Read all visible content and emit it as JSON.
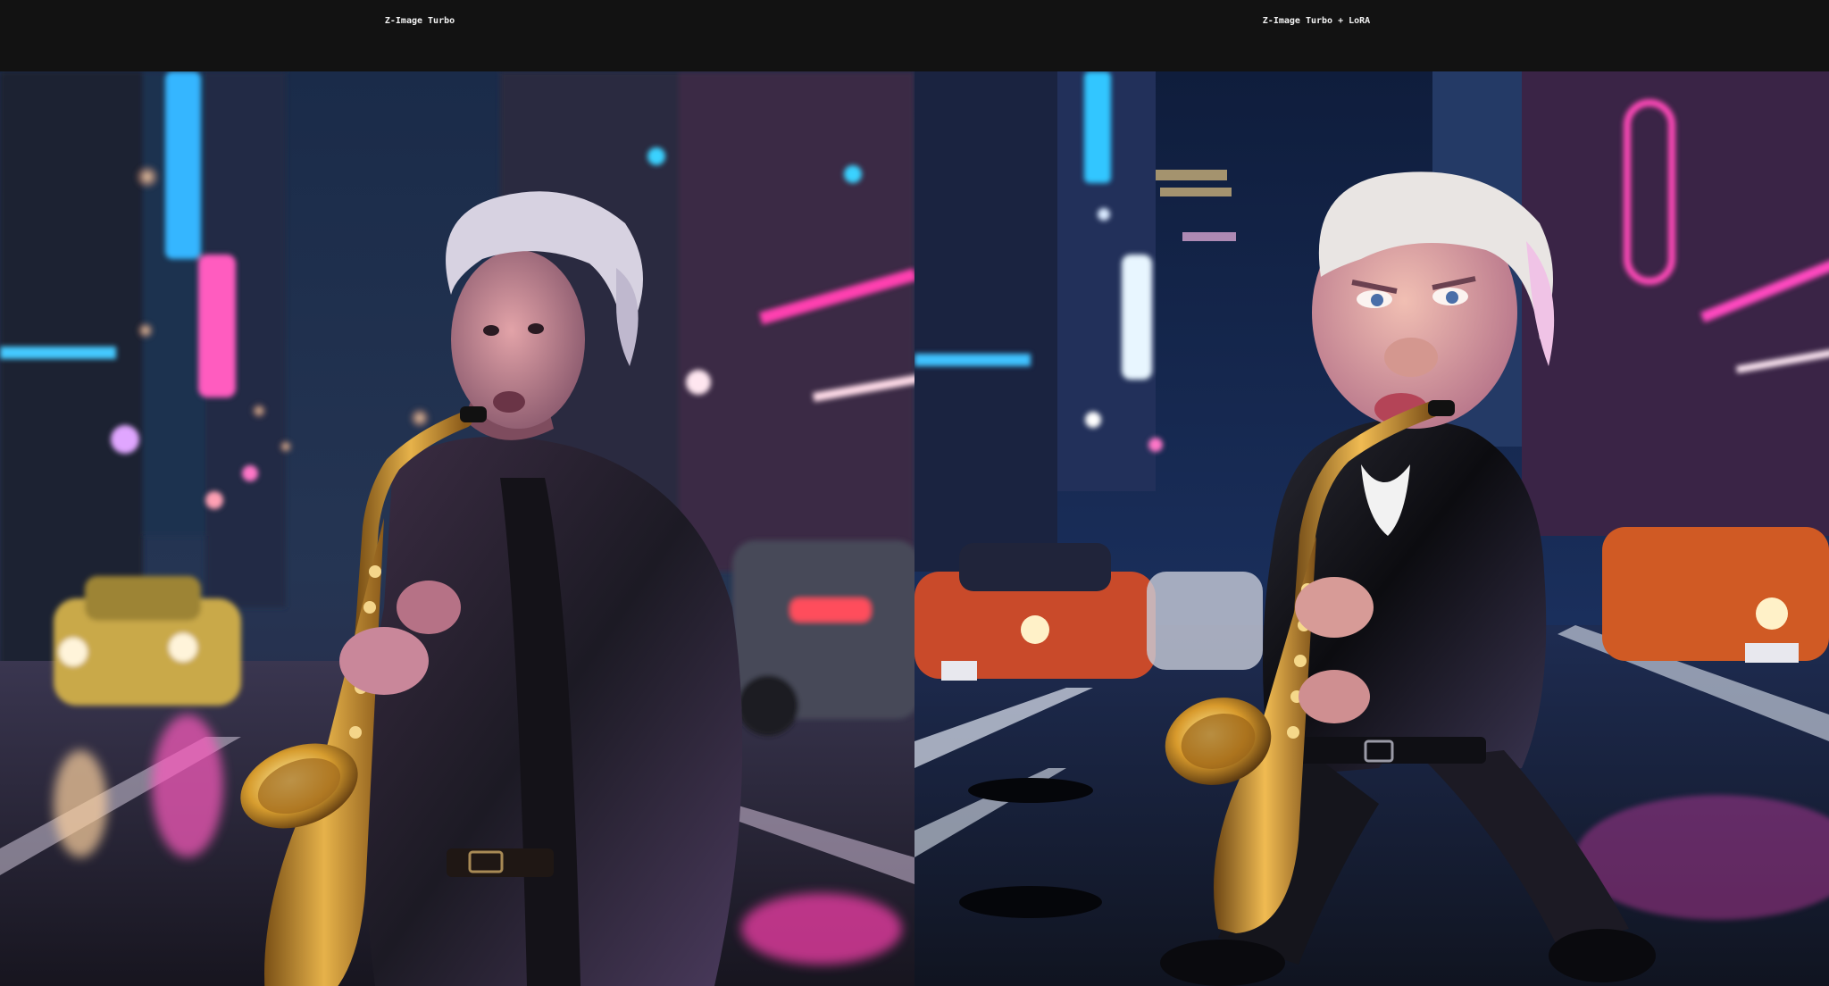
{
  "labels": {
    "left": "Z-Image Turbo",
    "right": "Z-Image Turbo + LoRA"
  },
  "palette": {
    "background": "#121212",
    "label_text": "#f2f2f2",
    "night_sky": "#14233f",
    "neon_pink": "#ff3fb0",
    "neon_cyan": "#34c8ff",
    "brass": "#c8902e",
    "leather": "#141418"
  },
  "images": {
    "left": {
      "subject": "elderly man with wild white hair playing a saxophone on a neon-lit rainy city street at night",
      "style": "photoreal"
    },
    "right": {
      "subject": "caricature of a white-haired man in a black leather jacket playing a saxophone on a neon-lit city street at night",
      "style": "caricature"
    }
  }
}
